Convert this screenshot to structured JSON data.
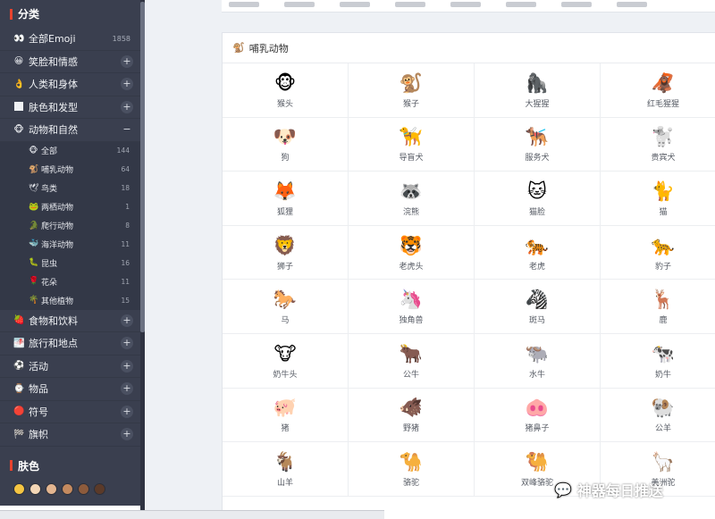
{
  "sidebar": {
    "categories_title": "分类",
    "categories": [
      {
        "icon": "👀",
        "label": "全部Emoji",
        "count": "1858",
        "toggle": ""
      },
      {
        "icon": "😀",
        "label": "笑脸和情感",
        "count": "",
        "toggle": "+"
      },
      {
        "icon": "👌",
        "label": "人类和身体",
        "count": "",
        "toggle": "+"
      },
      {
        "icon": "🏿",
        "label": "肤色和发型",
        "count": "",
        "toggle": "+"
      },
      {
        "icon": "🐵",
        "label": "动物和自然",
        "count": "",
        "toggle": "−"
      }
    ],
    "subcategories": [
      {
        "icon": "🐵",
        "label": "全部",
        "count": "144"
      },
      {
        "icon": "🐒",
        "label": "哺乳动物",
        "count": "64"
      },
      {
        "icon": "🕊",
        "label": "鸟类",
        "count": "18"
      },
      {
        "icon": "🐸",
        "label": "两栖动物",
        "count": "1"
      },
      {
        "icon": "🐊",
        "label": "爬行动物",
        "count": "8"
      },
      {
        "icon": "🐳",
        "label": "海洋动物",
        "count": "11"
      },
      {
        "icon": "🐛",
        "label": "昆虫",
        "count": "16"
      },
      {
        "icon": "🌹",
        "label": "花朵",
        "count": "11"
      },
      {
        "icon": "🌴",
        "label": "其他植物",
        "count": "15"
      }
    ],
    "categories_more": [
      {
        "icon": "🍓",
        "label": "食物和饮料",
        "toggle": "+"
      },
      {
        "icon": "🌁",
        "label": "旅行和地点",
        "toggle": "+"
      },
      {
        "icon": "⚽",
        "label": "活动",
        "toggle": "+"
      },
      {
        "icon": "⌚",
        "label": "物品",
        "toggle": "+"
      },
      {
        "icon": "🔴",
        "label": "符号",
        "toggle": "+"
      },
      {
        "icon": "🏁",
        "label": "旗帜",
        "toggle": "+"
      }
    ],
    "skin_title": "肤色",
    "skin_colors": [
      "#f5c542",
      "#f3d6b6",
      "#e3b590",
      "#c48a5f",
      "#8d5b3c",
      "#5b3a29"
    ]
  },
  "main": {
    "section_icon": "🐒",
    "section_title": "哺乳动物",
    "emojis": [
      {
        "emoji": "🐵",
        "name": "猴头"
      },
      {
        "emoji": "🐒",
        "name": "猴子"
      },
      {
        "emoji": "🦍",
        "name": "大猩猩"
      },
      {
        "emoji": "🦧",
        "name": "红毛猩猩"
      },
      {
        "emoji": "🐶",
        "name": "狗"
      },
      {
        "emoji": "🦮",
        "name": "导盲犬"
      },
      {
        "emoji": "🐕‍🦺",
        "name": "服务犬"
      },
      {
        "emoji": "🐩",
        "name": "贵宾犬"
      },
      {
        "emoji": "🦊",
        "name": "狐狸"
      },
      {
        "emoji": "🦝",
        "name": "浣熊"
      },
      {
        "emoji": "🐱",
        "name": "猫脸"
      },
      {
        "emoji": "🐈",
        "name": "猫"
      },
      {
        "emoji": "🦁",
        "name": "狮子"
      },
      {
        "emoji": "🐯",
        "name": "老虎头"
      },
      {
        "emoji": "🐅",
        "name": "老虎"
      },
      {
        "emoji": "🐆",
        "name": "豹子"
      },
      {
        "emoji": "🐎",
        "name": "马"
      },
      {
        "emoji": "🦄",
        "name": "独角兽"
      },
      {
        "emoji": "🦓",
        "name": "斑马"
      },
      {
        "emoji": "🦌",
        "name": "鹿"
      },
      {
        "emoji": "🐮",
        "name": "奶牛头"
      },
      {
        "emoji": "🐂",
        "name": "公牛"
      },
      {
        "emoji": "🐃",
        "name": "水牛"
      },
      {
        "emoji": "🐄",
        "name": "奶牛"
      },
      {
        "emoji": "🐖",
        "name": "猪"
      },
      {
        "emoji": "🐗",
        "name": "野猪"
      },
      {
        "emoji": "🐽",
        "name": "猪鼻子"
      },
      {
        "emoji": "🐏",
        "name": "公羊"
      },
      {
        "emoji": "🐐",
        "name": "山羊"
      },
      {
        "emoji": "🐪",
        "name": "骆驼"
      },
      {
        "emoji": "🐫",
        "name": "双峰骆驼"
      },
      {
        "emoji": "🦙",
        "name": "美洲驼"
      }
    ]
  },
  "watermark": {
    "icon": "💬",
    "text": "神器每日推送"
  }
}
